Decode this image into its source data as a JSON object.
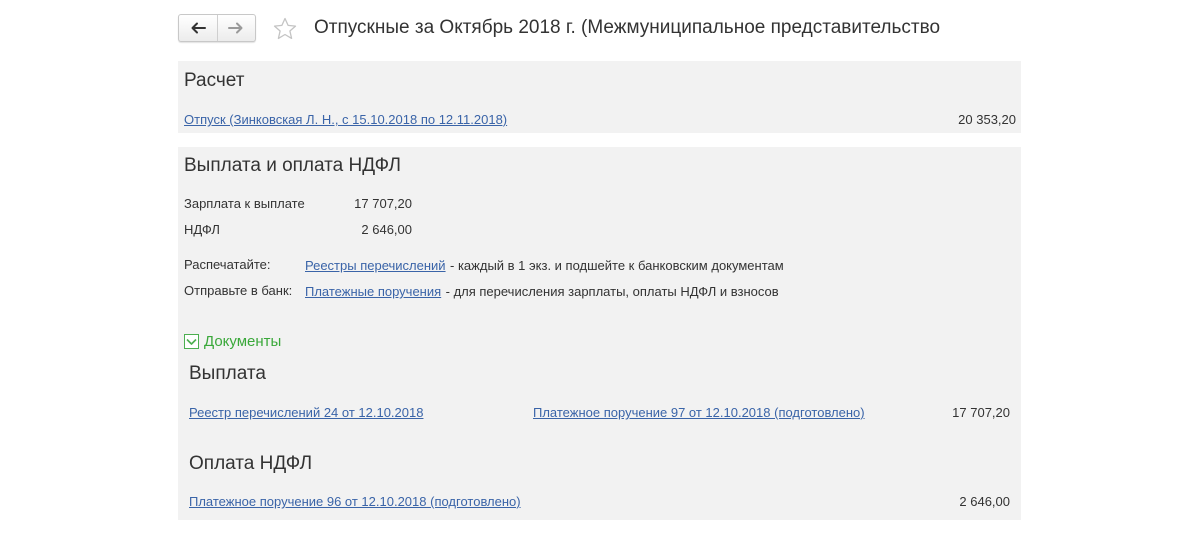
{
  "header": {
    "title": "Отпускные за Октябрь 2018 г. (Межмуниципальное представительство",
    "back_icon": "arrow-left-icon",
    "forward_icon": "arrow-right-icon",
    "favorite_icon": "star-icon"
  },
  "calculation": {
    "title": "Расчет",
    "link": "Отпуск (Зинковская Л. Н., с 15.10.2018 по 12.11.2018)",
    "amount": "20 353,20"
  },
  "payment": {
    "title": "Выплата и оплата НДФЛ",
    "rows": [
      {
        "label": "Зарплата к выплате",
        "value": "17 707,20"
      },
      {
        "label": "НДФЛ",
        "value": "2 646,00"
      }
    ],
    "print_label": "Распечатайте:",
    "print_link": "Реестры перечислений",
    "print_note": "- каждый в 1 экз. и подшейте к банковским документам",
    "send_label": "Отправьте в банк:",
    "send_link": "Платежные поручения",
    "send_note": "- для перечисления зарплаты, оплаты НДФЛ и взносов"
  },
  "documents": {
    "toggle_label": "Документы",
    "payout": {
      "title": "Выплата",
      "register_link": "Реестр перечислений 24 от 12.10.2018",
      "order_link": "Платежное поручение 97 от 12.10.2018 (подготовлено)",
      "amount": "17 707,20"
    },
    "tax": {
      "title": "Оплата НДФЛ",
      "order_link": "Платежное поручение 96 от 12.10.2018 (подготовлено)",
      "amount": "2 646,00"
    }
  },
  "colors": {
    "link": "#3a64a8",
    "panel": "#f2f2f2",
    "toggle": "#3aa83a"
  }
}
